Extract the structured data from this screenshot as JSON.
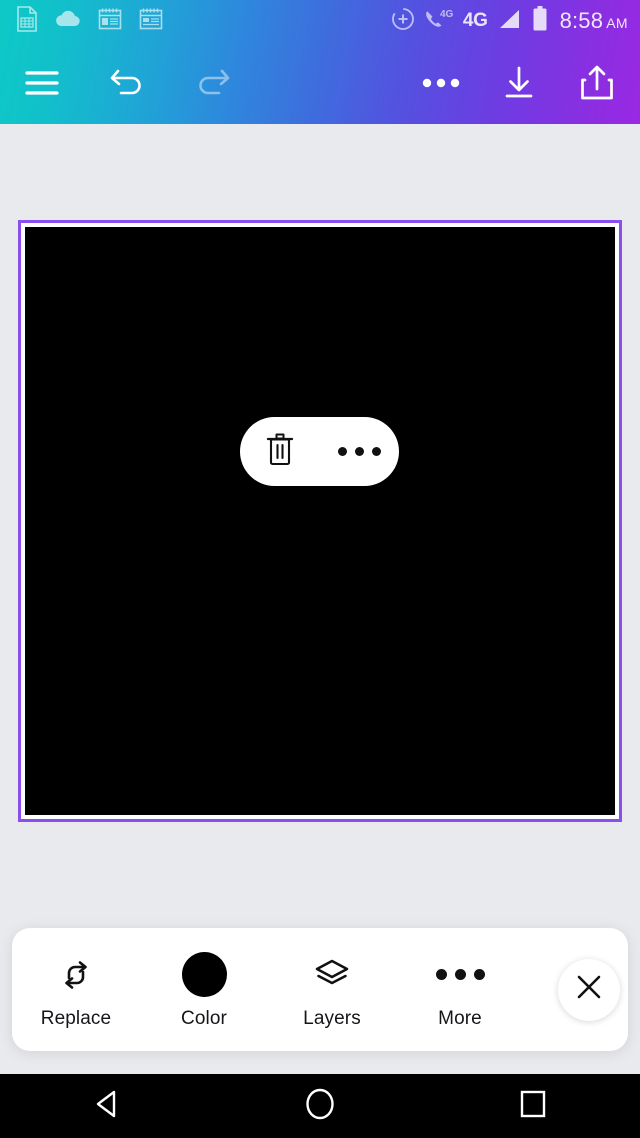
{
  "app": {
    "background_color": "#e9eaee",
    "accent_gradient_from": "#0dc9c6",
    "accent_gradient_mid": "#3e6ddd",
    "accent_gradient_to": "#9a28e4"
  },
  "status_bar": {
    "time": "8:58",
    "ampm": "AM",
    "network_label": "4G",
    "left_icons": [
      {
        "name": "spreadsheet-icon",
        "label": "Spreadsheet"
      },
      {
        "name": "cloud-icon",
        "label": "Cloud sync"
      },
      {
        "name": "notes-icon",
        "label": "Notes"
      },
      {
        "name": "notes-alt-icon",
        "label": "Notes"
      }
    ],
    "right_icons": [
      {
        "name": "add-circle-icon",
        "label": "Add"
      },
      {
        "name": "phone-4g-icon",
        "label": "Phone 4G"
      },
      {
        "name": "signal-icon",
        "label": "Signal"
      },
      {
        "name": "battery-icon",
        "label": "Battery"
      }
    ]
  },
  "toolbar": {
    "menu_label": "Menu",
    "undo_label": "Undo",
    "redo_label": "Redo",
    "more_label": "More options",
    "download_label": "Download",
    "share_label": "Share"
  },
  "canvas": {
    "fill_color": "#000000",
    "selection_color": "#8b4ff0",
    "selection_gap_color": "#ffffff",
    "element_actions": [
      {
        "name": "delete-button",
        "label": "Delete"
      },
      {
        "name": "element-more-button",
        "label": "More"
      }
    ]
  },
  "bottom_toolbar": {
    "items": [
      {
        "label": "Replace",
        "icon": "replace-icon"
      },
      {
        "label": "Color",
        "icon": "color-swatch-icon",
        "swatch": "#000000"
      },
      {
        "label": "Layers",
        "icon": "layers-icon"
      },
      {
        "label": "More",
        "icon": "more-dots-icon"
      }
    ],
    "close_label": "Close"
  },
  "nav_bar": {
    "back_label": "Back",
    "home_label": "Home",
    "recents_label": "Recents"
  }
}
